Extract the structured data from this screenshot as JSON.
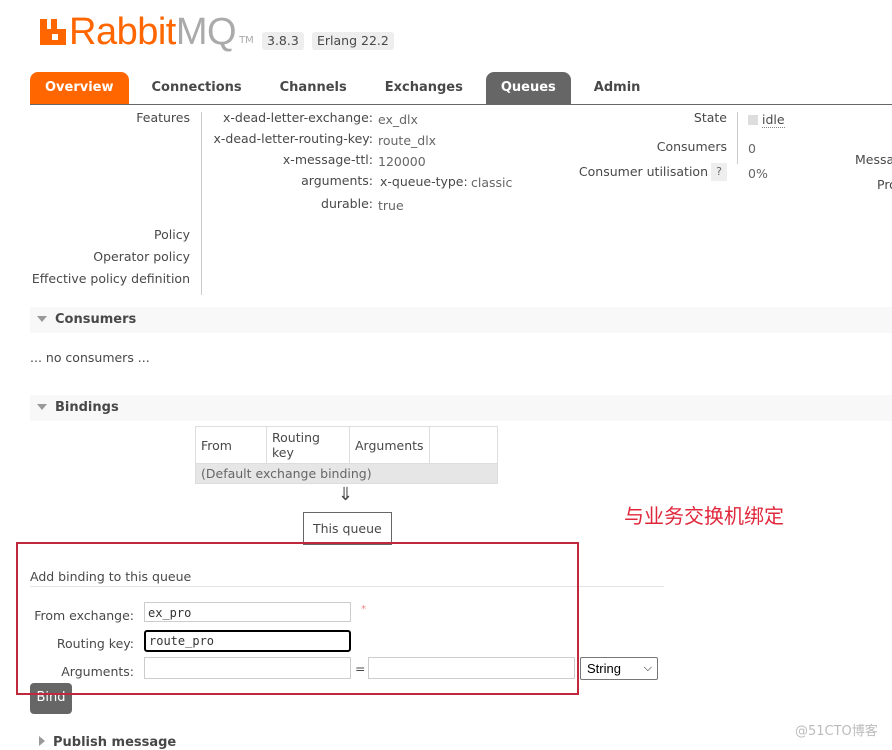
{
  "header": {
    "brand_rabbit": "Rabbit",
    "brand_mq": "MQ",
    "trademark": "TM",
    "version": "3.8.3",
    "erlang": "Erlang 22.2"
  },
  "tabs": [
    {
      "label": "Overview"
    },
    {
      "label": "Connections"
    },
    {
      "label": "Channels"
    },
    {
      "label": "Exchanges"
    },
    {
      "label": "Queues"
    },
    {
      "label": "Admin"
    }
  ],
  "details": {
    "features_label": "Features",
    "features": [
      {
        "key": "x-dead-letter-exchange:",
        "value": "ex_dlx"
      },
      {
        "key": "x-dead-letter-routing-key:",
        "value": "route_dlx"
      },
      {
        "key": "x-message-ttl:",
        "value": "120000"
      },
      {
        "key": "arguments:",
        "subkey": "x-queue-type:",
        "value": "classic"
      },
      {
        "key": "durable:",
        "value": "true"
      }
    ],
    "policy_label": "Policy",
    "operator_policy_label": "Operator policy",
    "effective_policy_label": "Effective policy definition",
    "state_label": "State",
    "state_value": "idle",
    "consumers_label": "Consumers",
    "consumers_value": "0",
    "consumer_util_label": "Consumer utilisation",
    "help": "?",
    "consumer_util_value": "0%",
    "messages_label_partial": "Messa",
    "pro_label_partial": "Pro"
  },
  "consumers": {
    "title": "Consumers",
    "empty": "... no consumers ..."
  },
  "bindings": {
    "title": "Bindings",
    "columns": [
      "From",
      "Routing key",
      "Arguments",
      ""
    ],
    "rows": [
      {
        "text": "(Default exchange binding)"
      }
    ],
    "arrow": "⇓",
    "this_queue": "This queue"
  },
  "add_binding": {
    "title": "Add binding to this queue",
    "from_label": "From exchange:",
    "from_value": "ex_pro",
    "required_mark": "*",
    "routing_label": "Routing key:",
    "routing_value": "route_pro",
    "arguments_label": "Arguments:",
    "arg_key": "",
    "equals": "=",
    "arg_value": "",
    "arg_type": "String",
    "bind_button": "Bind"
  },
  "publish": {
    "title": "Publish message"
  },
  "annotation": {
    "text": "与业务交换机绑定",
    "color": "#e0283c"
  },
  "watermark": "@51CTO博客"
}
